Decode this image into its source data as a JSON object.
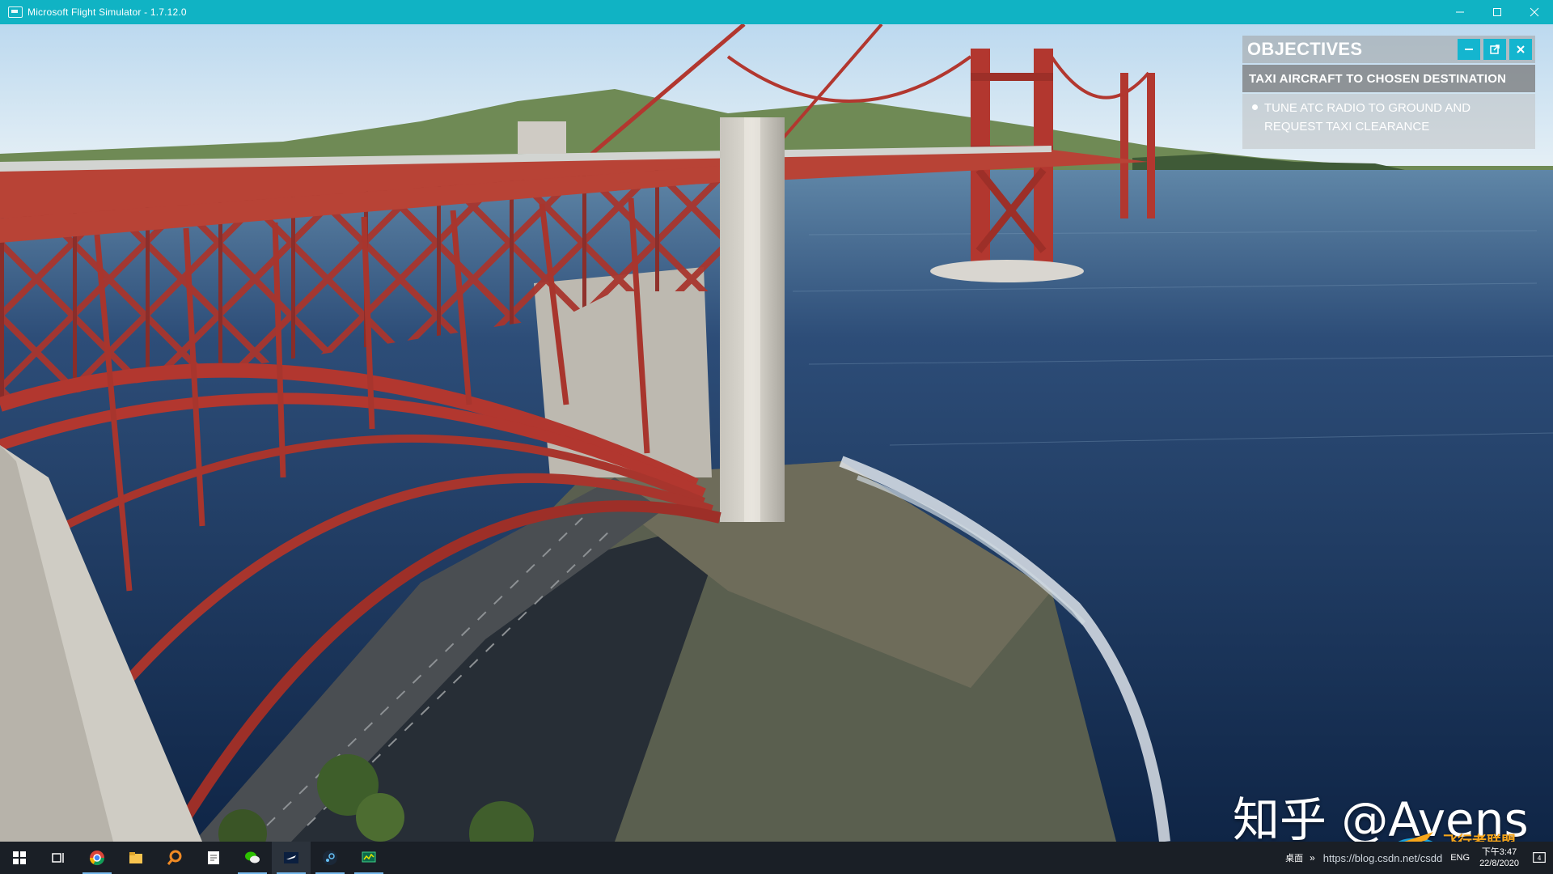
{
  "window": {
    "title": "Microsoft Flight Simulator - 1.7.12.0",
    "controls": [
      "minimize-icon",
      "maximize-icon",
      "close-icon"
    ]
  },
  "objectives": {
    "title": "OBJECTIVES",
    "current": "TAXI AIRCRAFT TO CHOSEN DESTINATION",
    "tasks": [
      "TUNE ATC RADIO TO GROUND AND REQUEST TAXI CLEARANCE"
    ],
    "buttons": [
      "minimize-icon",
      "popout-icon",
      "close-icon"
    ],
    "accent": "#14b5cf"
  },
  "watermark": {
    "text": "知乎 @Avens",
    "logo_text": "飞行者联盟"
  },
  "taskbar": {
    "items": [
      "windows-start-icon",
      "task-view-icon",
      "chrome-icon",
      "file-explorer-icon",
      "search-app-icon",
      "notepad-icon",
      "wechat-icon",
      "flight-simulator-icon",
      "steam-icon",
      "monitor-app-icon"
    ],
    "tray": {
      "desktop_label": "桌面",
      "chevron": "»",
      "url": "https://blog.csdn.net/csdd",
      "language": "ENG",
      "time": "下午3:47",
      "date": "22/8/2020",
      "notification_count": "4"
    }
  },
  "colors": {
    "titlebar": "#10b3c4",
    "bridge_red": "#b2372f",
    "water": "#1d3a63"
  }
}
